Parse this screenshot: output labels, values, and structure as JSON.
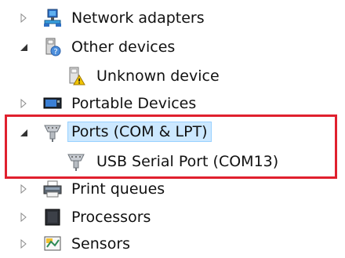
{
  "tree": {
    "items": [
      {
        "label": "Network adapters",
        "icon": "network-adapter-icon",
        "expanded": false
      },
      {
        "label": "Other devices",
        "icon": "other-devices-icon",
        "expanded": true
      },
      {
        "label": "Unknown device",
        "icon": "unknown-device-icon"
      },
      {
        "label": "Portable Devices",
        "icon": "portable-devices-icon",
        "expanded": false
      },
      {
        "label": "Ports (COM & LPT)",
        "icon": "ports-icon",
        "expanded": true,
        "selected": true
      },
      {
        "label": "USB Serial Port (COM13)",
        "icon": "usb-serial-port-icon"
      },
      {
        "label": "Print queues",
        "icon": "printer-icon",
        "expanded": false
      },
      {
        "label": "Processors",
        "icon": "processor-icon",
        "expanded": false
      },
      {
        "label": "Sensors",
        "icon": "sensor-icon",
        "expanded": false
      }
    ]
  },
  "colors": {
    "highlight_border": "#e0202e",
    "selection_fill": "#cce8ff",
    "selection_border": "#99d1ff"
  }
}
